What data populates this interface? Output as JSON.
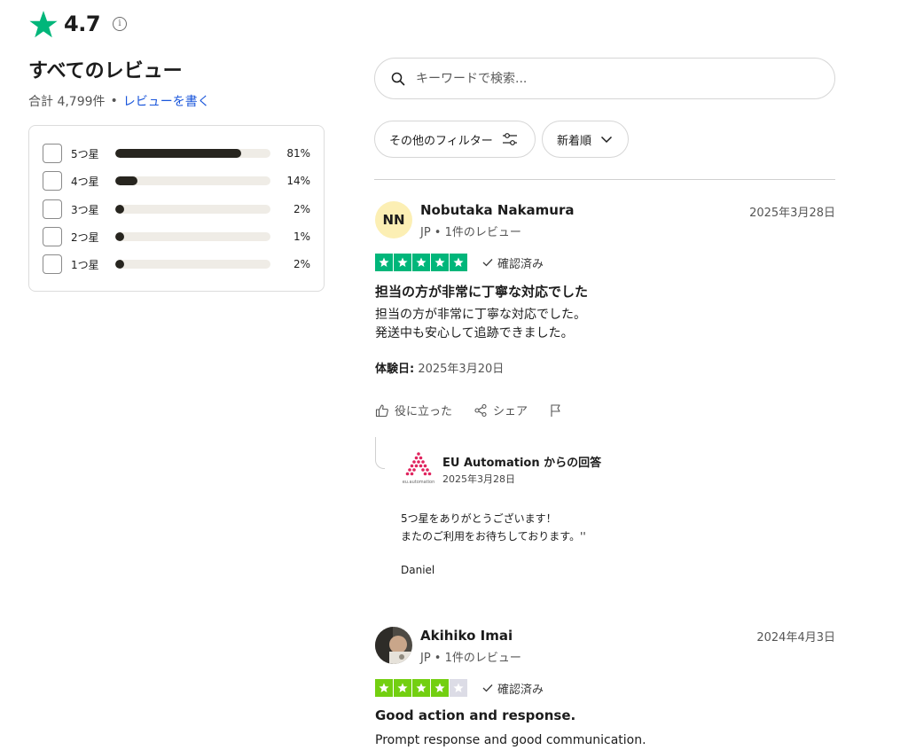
{
  "header": {
    "rating": "4.7",
    "info_glyph": "i",
    "star_color": "#00b67a"
  },
  "summary": {
    "title": "すべてのレビュー",
    "total": "合計 4,799件",
    "separator": "•",
    "write_review": "レビューを書く"
  },
  "distribution": [
    {
      "label": "5つ星",
      "percent_text": "81%",
      "fraction": 0.81
    },
    {
      "label": "4つ星",
      "percent_text": "14%",
      "fraction": 0.14
    },
    {
      "label": "3つ星",
      "percent_text": "2%",
      "fraction": 0.02
    },
    {
      "label": "2つ星",
      "percent_text": "1%",
      "fraction": 0.01
    },
    {
      "label": "1つ星",
      "percent_text": "2%",
      "fraction": 0.02
    }
  ],
  "search": {
    "placeholder": "キーワードで検索..."
  },
  "filters": {
    "other_filters": "その他のフィルター",
    "sort": "新着順"
  },
  "reviews": [
    {
      "avatar_initials": "NN",
      "name": "Nobutaka Nakamura",
      "meta": "JP • 1件のレビュー",
      "date": "2025年3月28日",
      "stars": 5,
      "star_color": "#00b67a",
      "verified": "確認済み",
      "title": "担当の方が非常に丁寧な対応でした",
      "body_line1": "担当の方が非常に丁寧な対応でした。",
      "body_line2": "発送中も安心して追跡できました。",
      "experience_label": "体験日:",
      "experience_date": "2025年3月20日",
      "helpful": "役に立った",
      "share": "シェア",
      "reply": {
        "from": "EU Automation からの回答",
        "logo_text": "eu.automation",
        "date": "2025年3月28日",
        "line1": "5つ星をありがとうございます！",
        "line2": "またのご利用をお待ちしております。''",
        "signature": "Daniel"
      }
    },
    {
      "name": "Akihiko Imai",
      "meta": "JP • 1件のレビュー",
      "date": "2024年4月3日",
      "stars": 4,
      "star_color": "#73cf11",
      "verified": "確認済み",
      "title": "Good action and response.",
      "body_line1": "Prompt response and good communication."
    }
  ]
}
